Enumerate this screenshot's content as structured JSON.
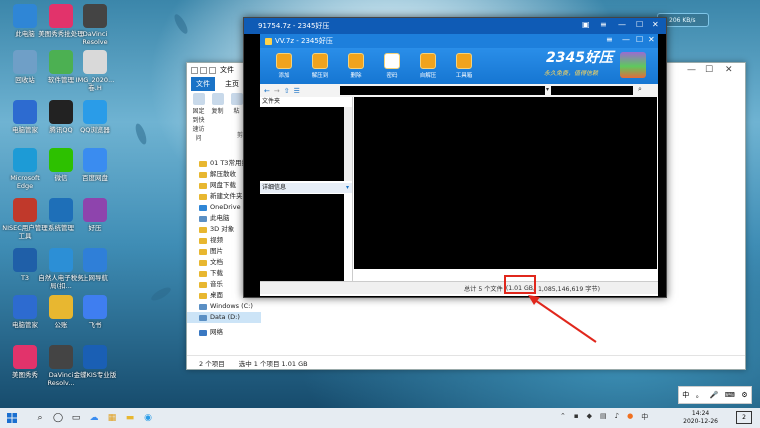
{
  "desktop": {
    "icons": [
      {
        "label": "此电脑",
        "icon": "computer-icon",
        "color": "#2f86d6"
      },
      {
        "label": "美图秀秀批处理",
        "icon": "meitu-batch-icon",
        "color": "#e2336b"
      },
      {
        "label": "DaVinci Resolve",
        "icon": "davinci-icon",
        "color": "#444444"
      },
      {
        "label": "回收站",
        "icon": "recycle-bin-icon",
        "color": "#6f9fc7"
      },
      {
        "label": "软件管理",
        "icon": "software-manager-icon",
        "color": "#4cb052"
      },
      {
        "label": "IMG_2020...卷.H",
        "icon": "image-file-icon",
        "color": "#d9d9d9"
      },
      {
        "label": "电脑管家",
        "icon": "pc-manager-icon",
        "color": "#2d6bd0"
      },
      {
        "label": "腾讯QQ",
        "icon": "qq-icon",
        "color": "#222222"
      },
      {
        "label": "QQ浏览器",
        "icon": "qq-browser-icon",
        "color": "#2a9ce8"
      },
      {
        "label": "Microsoft Edge",
        "icon": "edge-icon",
        "color": "#1d9bd6"
      },
      {
        "label": "微信",
        "icon": "wechat-icon",
        "color": "#2dc100"
      },
      {
        "label": "百度网盘",
        "icon": "baidu-netdisk-icon",
        "color": "#3a8cf0"
      },
      {
        "label": "NISEC用户管理工具",
        "icon": "nisec-icon",
        "color": "#c0392b"
      },
      {
        "label": "系统管理",
        "icon": "system-manager-icon",
        "color": "#1e6fb8"
      },
      {
        "label": "好压",
        "icon": "haozip-icon",
        "color": "#8e44ad"
      },
      {
        "label": "T3",
        "icon": "t3-icon",
        "color": "#1f5fa8"
      },
      {
        "label": "自然人电子税务局(扣...",
        "icon": "tax-icon",
        "color": "#2c8fd6"
      },
      {
        "label": "上网导航",
        "icon": "ie-icon",
        "color": "#2f7fd8"
      },
      {
        "label": "电脑管家",
        "icon": "shield-icon",
        "color": "#2d6bd0"
      },
      {
        "label": "公账",
        "icon": "folder-icon",
        "color": "#e8b730"
      },
      {
        "label": "飞书",
        "icon": "feishu-icon",
        "color": "#3f7ef0"
      },
      {
        "label": "美图秀秀",
        "icon": "meitu-icon",
        "color": "#e2336b"
      },
      {
        "label": "DaVinci Resolv...",
        "icon": "davinci-icon",
        "color": "#444444"
      },
      {
        "label": "金蝶KIS专业版",
        "icon": "kingdee-icon",
        "color": "#1a5fb4"
      }
    ],
    "speed_widget": {
      "icon": "cloud-icon",
      "text": "206 KB/s"
    }
  },
  "explorer": {
    "title_tab": "文件",
    "ribbon": [
      "文件",
      "主页",
      "共享",
      "查看"
    ],
    "tools": [
      {
        "label": "固定到快速访问",
        "icon": "pin-icon"
      },
      {
        "label": "复制",
        "icon": "copy-icon"
      },
      {
        "label": "粘",
        "icon": "paste-icon"
      }
    ],
    "clipboard_label": "剪",
    "nav": [
      {
        "label": "01 T3常用数",
        "kind": "folder"
      },
      {
        "label": "解压散收",
        "kind": "folder"
      },
      {
        "label": "网盘下载",
        "kind": "folder"
      },
      {
        "label": "新建文件夹",
        "kind": "folder"
      },
      {
        "label": "OneDrive",
        "kind": "cloud"
      },
      {
        "label": "此电脑",
        "kind": "pc"
      },
      {
        "label": "3D 对象",
        "kind": "folder"
      },
      {
        "label": "视频",
        "kind": "folder"
      },
      {
        "label": "图片",
        "kind": "folder"
      },
      {
        "label": "文档",
        "kind": "folder"
      },
      {
        "label": "下载",
        "kind": "folder"
      },
      {
        "label": "音乐",
        "kind": "folder"
      },
      {
        "label": "桌面",
        "kind": "folder"
      },
      {
        "label": "Windows (C:)",
        "kind": "drive"
      },
      {
        "label": "Data (D:)",
        "kind": "drive"
      },
      {
        "label": "网络",
        "kind": "network"
      }
    ],
    "mid_labels": [
      "详",
      "VV",
      "好",
      "修",
      "压",
      "大",
      "压",
      "压"
    ],
    "status": [
      "2 个项目",
      "选中 1 个项目  1.01 GB"
    ]
  },
  "zip_outer": {
    "title": "91754.7z - 2345好压"
  },
  "zip_inner": {
    "title": "VV.7z - 2345好压",
    "toolbar": [
      {
        "label": "添加",
        "icon": "add-icon",
        "color": "#f0a31d"
      },
      {
        "label": "解压到",
        "icon": "extract-icon",
        "color": "#f0a31d"
      },
      {
        "label": "删除",
        "icon": "delete-icon",
        "color": "#f0a31d"
      },
      {
        "label": "密码",
        "icon": "lock-icon",
        "color": "#ffffff"
      },
      {
        "label": "自解压",
        "icon": "self-extract-icon",
        "color": "#f0a31d"
      },
      {
        "label": "工具箱",
        "icon": "toolbox-icon",
        "color": "#f0a31d"
      }
    ],
    "brand": "2345好压",
    "slogan": "永久免费，值得信赖",
    "folder_header": "文件夹",
    "details_header": "详细信息",
    "status": {
      "prefix": "总计 5 个文件",
      "size": "(1.01 GB,",
      "bytes": "1,085,146,619 字节)"
    }
  },
  "ime": [
    "中",
    "。",
    "🎤",
    "⌨",
    "⚙"
  ],
  "taskbar": {
    "time": "14:24",
    "date": "2020-12-26",
    "notification_count": "2"
  }
}
